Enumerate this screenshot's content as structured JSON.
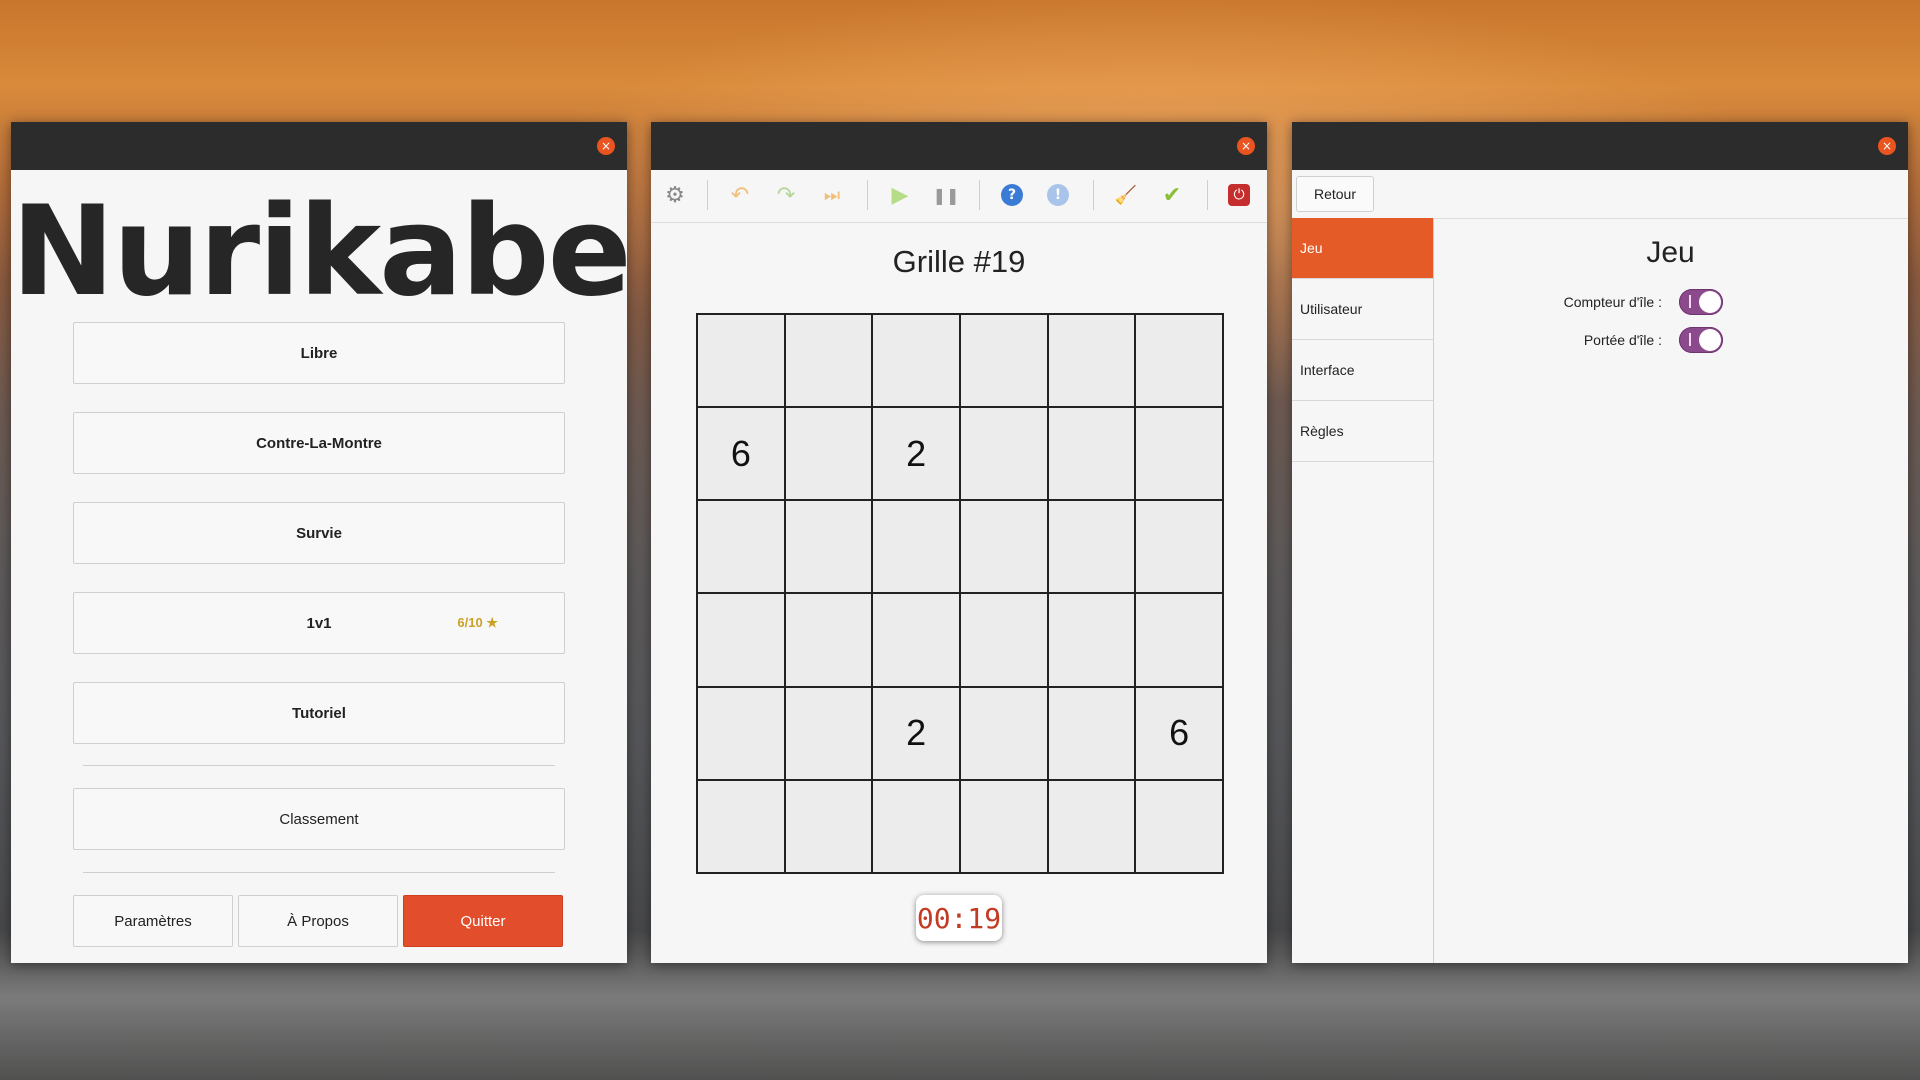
{
  "menu": {
    "title": "Nurikabe",
    "close": "×",
    "buttons": {
      "libre": "Libre",
      "contre": "Contre-La-Montre",
      "survie": "Survie",
      "v1": "1v1",
      "v1_score": "6/10 ★",
      "tutoriel": "Tutoriel",
      "classement": "Classement"
    },
    "bottom": {
      "parametres": "Paramètres",
      "apropos": "À Propos",
      "quitter": "Quitter"
    }
  },
  "game": {
    "close": "×",
    "toolbar": {
      "settings": "⚙",
      "undo": "↶",
      "redo": "↷",
      "skip": "⏭",
      "play": "▶",
      "pause": "❚❚",
      "help": "?",
      "hint": "!",
      "clean": "🧹",
      "check": "✔",
      "power": "⏻"
    },
    "title": "Grille #19",
    "grid": [
      [
        "",
        "",
        "",
        "",
        "",
        ""
      ],
      [
        "6",
        "",
        "2",
        "",
        "",
        ""
      ],
      [
        "",
        "",
        "",
        "",
        "",
        ""
      ],
      [
        "",
        "",
        "",
        "",
        "",
        ""
      ],
      [
        "",
        "",
        "2",
        "",
        "",
        "6"
      ],
      [
        "",
        "",
        "",
        "",
        "",
        ""
      ]
    ],
    "timer": "00:19"
  },
  "settings": {
    "close": "×",
    "back": "Retour",
    "sidebar": [
      "Jeu",
      "Utilisateur",
      "Interface",
      "Règles"
    ],
    "panel_title": "Jeu",
    "options": {
      "compteur": "Compteur d'île :",
      "portee": "Portée d'île :"
    }
  },
  "colors": {
    "accent": "#e45b27",
    "quit": "#e24d2b",
    "toggle": "#8a4a8c",
    "timer": "#c23b22"
  }
}
